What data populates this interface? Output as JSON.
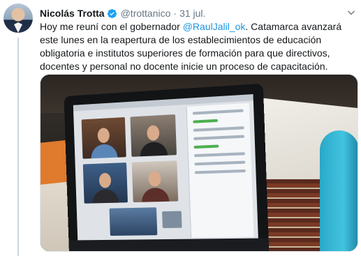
{
  "tweet": {
    "author_name": "Nicolás Trotta",
    "handle": "@trottanico",
    "separator": "·",
    "date": "31 jul.",
    "text_before_mention": "Hoy me reuní con el gobernador ",
    "mention": "@RaulJalil_ok",
    "text_after_mention": ". Catamarca avanzará este lunes en la reapertura de los establecimientos de educación obligatoria e institutos superiores de formación para que directivos, docentes y personal no docente inicie un proceso de capacitación."
  },
  "icons": {
    "verified": "verified-badge-icon",
    "more": "chevron-down-icon"
  },
  "colors": {
    "link": "#1b95e0",
    "verified": "#1da1f2",
    "secondary_text": "#657786",
    "thread_line": "#ccd6dd"
  }
}
